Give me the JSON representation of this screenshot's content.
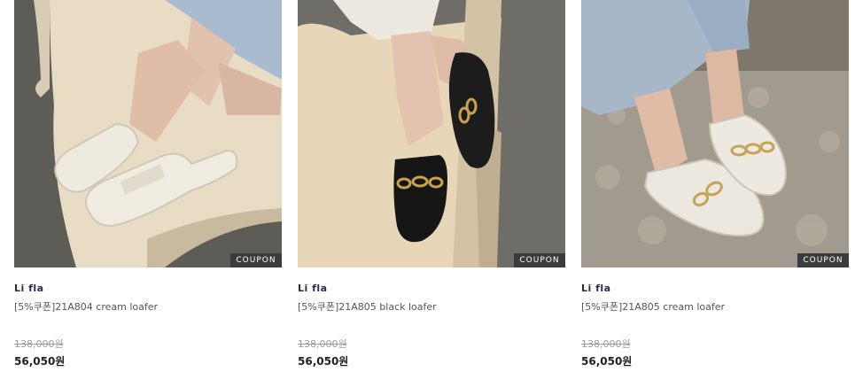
{
  "products": [
    {
      "brand": "Li fla",
      "name": "[5%쿠폰]21A804 cream loafer",
      "original_price": "138,000원",
      "sale_price": "56,050원",
      "badge": "COUPON",
      "image_icon": "cream-loafer-photo"
    },
    {
      "brand": "Li fla",
      "name": "[5%쿠폰]21A805 black loafer",
      "original_price": "138,000원",
      "sale_price": "56,050원",
      "badge": "COUPON",
      "image_icon": "black-loafer-photo"
    },
    {
      "brand": "Li fla",
      "name": "[5%쿠폰]21A805 cream loafer",
      "original_price": "138,000원",
      "sale_price": "56,050원",
      "badge": "COUPON",
      "image_icon": "cream-chain-loafer-photo"
    }
  ],
  "colors": {
    "brand_text": "#2a2a4a",
    "badge_bg": "#3b3b3b",
    "cream_shoe": "#ebe6d8",
    "black_shoe": "#1a1a1a",
    "denim": "#9fb3c8"
  }
}
